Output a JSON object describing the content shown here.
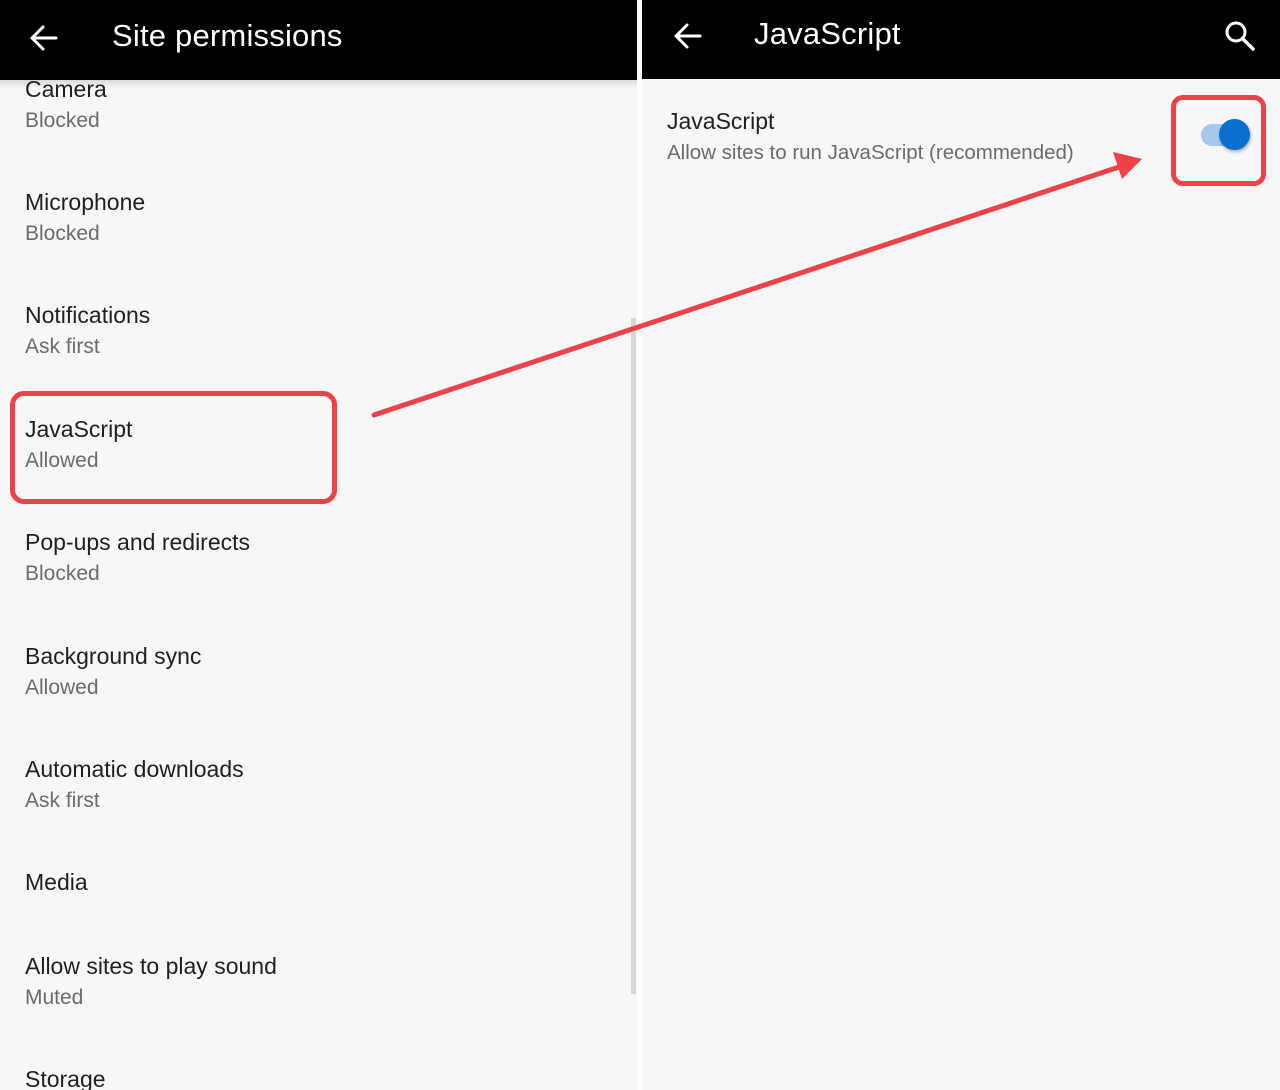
{
  "left_screen": {
    "title": "Site permissions",
    "back_icon": "arrow-back-icon",
    "items": [
      {
        "label": "Camera",
        "value": "Blocked"
      },
      {
        "label": "Microphone",
        "value": "Blocked"
      },
      {
        "label": "Notifications",
        "value": "Ask first"
      },
      {
        "label": "JavaScript",
        "value": "Allowed"
      },
      {
        "label": "Pop-ups and redirects",
        "value": "Blocked"
      },
      {
        "label": "Background sync",
        "value": "Allowed"
      },
      {
        "label": "Automatic downloads",
        "value": "Ask first"
      },
      {
        "label": "Media",
        "value": null
      },
      {
        "label": "Allow sites to play sound",
        "value": "Muted"
      },
      {
        "label": "Storage",
        "value": null
      }
    ]
  },
  "right_screen": {
    "title": "JavaScript",
    "back_icon": "arrow-back-icon",
    "search_icon": "search-icon",
    "setting": {
      "label": "JavaScript",
      "description": "Allow sites to run JavaScript (recommended)",
      "enabled": true
    }
  },
  "annotation": {
    "color": "#ee4148",
    "highlighted_left": "JavaScript",
    "highlighted_right": "JavaScript toggle"
  },
  "colors": {
    "appbar": "#000000",
    "background": "#f7f7f7",
    "toggle_thumb": "#0a6fd1",
    "toggle_track": "#a5c8ec"
  }
}
